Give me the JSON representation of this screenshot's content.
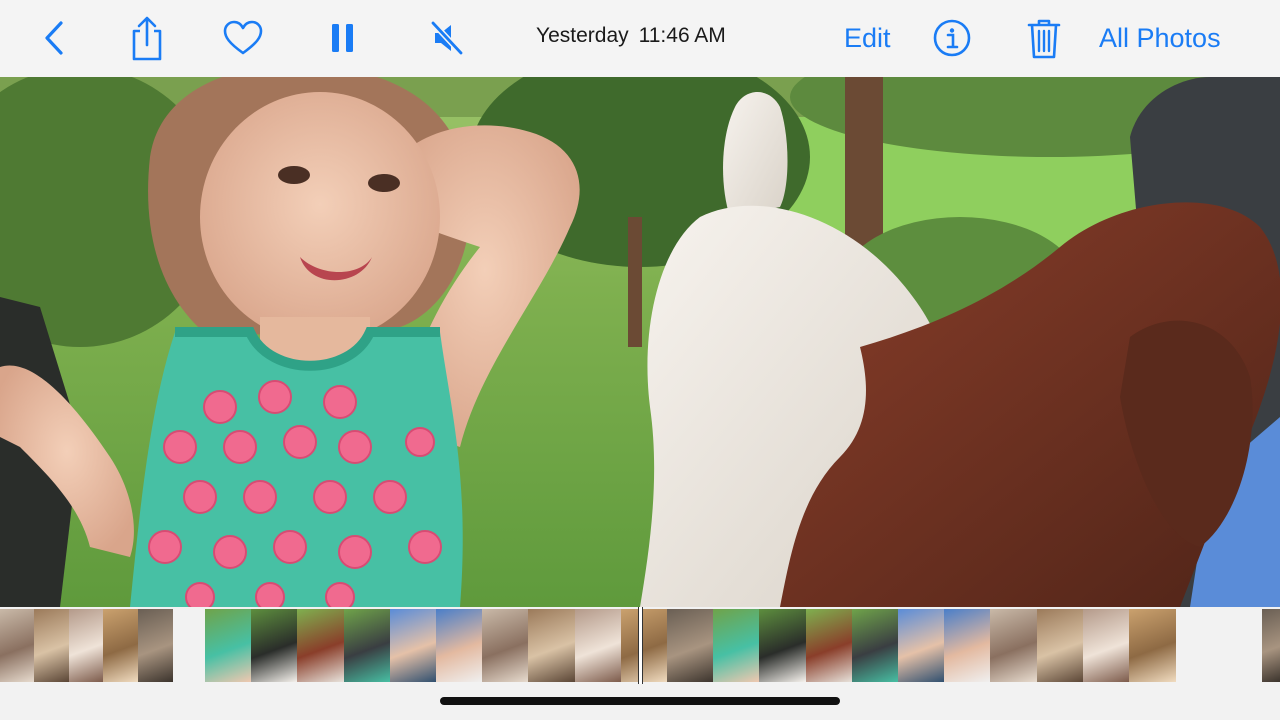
{
  "toolbar": {
    "date": "Yesterday",
    "time": "11:46 AM",
    "edit_label": "Edit",
    "all_photos_label": "All Photos",
    "accent_color": "#1a7cf5",
    "icons": [
      "back-chevron-icon",
      "share-icon",
      "heart-icon",
      "pause-icon",
      "mute-icon",
      "info-icon",
      "trash-icon"
    ]
  },
  "viewer": {
    "content": "photo"
  },
  "filmstrip": {
    "groups": [
      {
        "thumbs": 5
      },
      {
        "thumbs": 22
      }
    ]
  }
}
